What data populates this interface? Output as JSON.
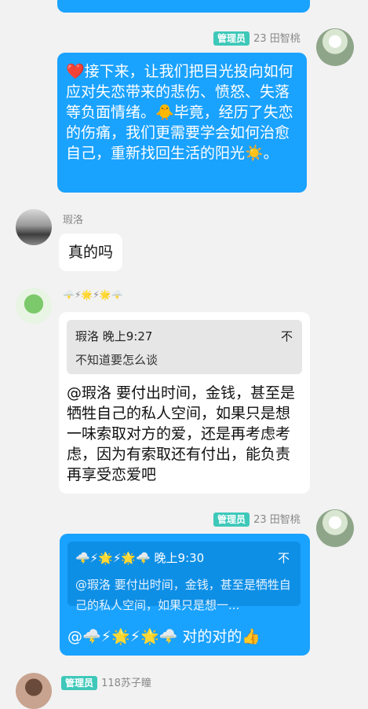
{
  "colors": {
    "bg": "#f2f2f2",
    "blue": "#1aa2ff",
    "badge": "#3ec8b9"
  },
  "messages": [
    {
      "sender_badge": "管理员",
      "sender_name": "23 田智桃",
      "text": "❤️接下来，让我们把目光投向如何应对失恋带来的悲伤、愤怒、失落等负面情绪。🐥毕竟，经历了失恋的伤痛，我们更需要学会如何治愈自己，重新找回生活的阳光☀️。"
    },
    {
      "sender_name": "瑕洛",
      "text": "真的吗"
    },
    {
      "sender_name": "🌩️⚡🌟⚡🌟🌩️",
      "quote": {
        "author": "瑕洛 晚上9:27",
        "text": "不知道要怎么谈",
        "trailing": "不"
      },
      "text": "@瑕洛 要付出时间，金钱，甚至是牺牲自己的私人空间，如果只是想一味索取对方的爱，还是再考虑考虑，因为有索取还有付出，能负责再享受恋爱吧"
    },
    {
      "sender_badge": "管理员",
      "sender_name": "23 田智桃",
      "quote": {
        "author": "🌩️⚡🌟⚡🌟🌩️ 晚上9:30",
        "text": "@瑕洛 要付出时间，金钱，甚至是牺牲自己的私人空间，如果只是想一...",
        "trailing": "不"
      },
      "text": "@🌩️⚡🌟⚡🌟🌩️ 对的对的👍"
    },
    {
      "sender_badge": "管理员",
      "sender_name": "118苏子瞳"
    }
  ]
}
